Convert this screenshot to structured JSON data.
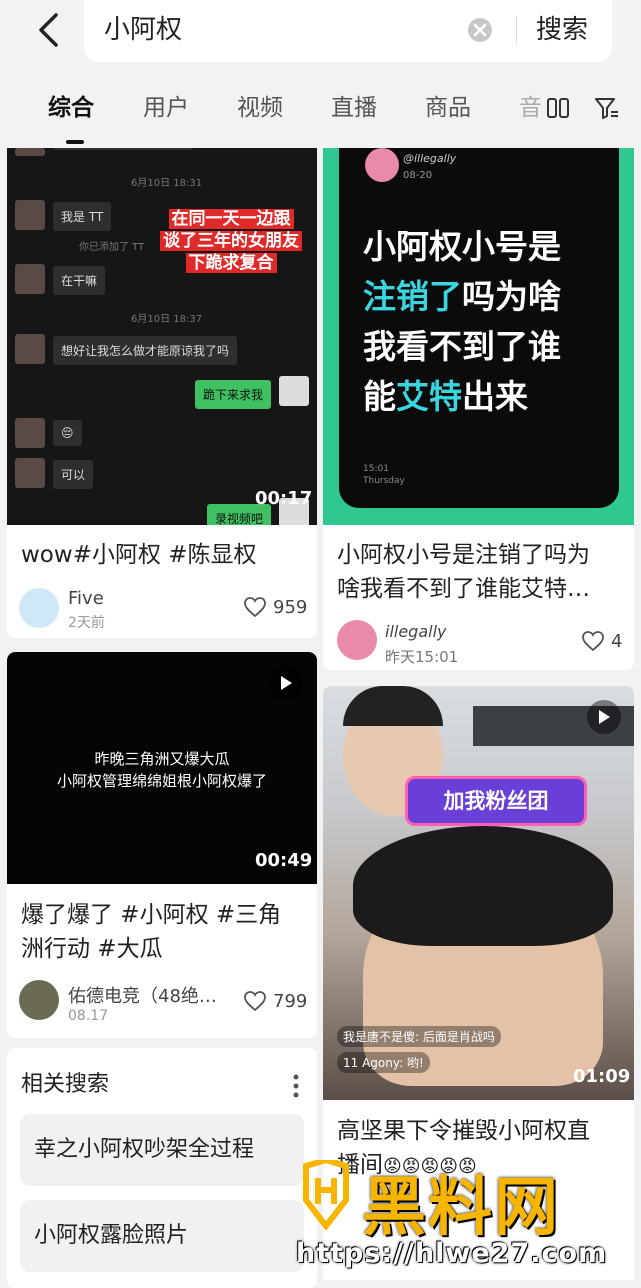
{
  "search": {
    "query": "小阿权",
    "button": "搜索"
  },
  "tabs": [
    "综合",
    "用户",
    "视频",
    "直播",
    "商品",
    "音"
  ],
  "cards": [
    {
      "title": "wow#小阿权 #陈显权",
      "author": "Five",
      "date": "2天前",
      "likes": "959",
      "duration": "00:17",
      "chat": {
        "times": [
          "6月10日 18:31",
          "6月10日 18:37"
        ],
        "added": "你已添加了 TT",
        "messages": [
          "我是 TT",
          "在干嘛",
          "想好让我怎么做才能原谅我了吗",
          "跪下来求我",
          "😔",
          "可以",
          "录视频吧"
        ],
        "overlay": [
          "在同一天一边跟",
          "谈了三年的女朋友",
          "下跪求复合"
        ]
      }
    },
    {
      "title_lines": [
        "小阿权小号是注销了吗为",
        "啥我看不到了谁能艾特…"
      ],
      "author": "illegally",
      "date": "昨天15:01",
      "likes": "4",
      "thumb": {
        "handle": "@illegally",
        "date": "08-20",
        "lines": [
          "小阿权小号是",
          "注销了",
          "吗为啥",
          "我看不到了谁",
          "能",
          "艾特",
          "出来"
        ],
        "time": "15:01",
        "day": "Thursday"
      }
    },
    {
      "title_lines": [
        "爆了爆了 #小阿权 #三角",
        "洲行动 #大瓜"
      ],
      "author": "佑德电竞（48绝…",
      "date": "08.17",
      "likes": "799",
      "duration": "00:49",
      "thumb_lines": [
        "昨晚三角洲又爆大瓜",
        "小阿权管理绵绵姐根小阿权爆了"
      ]
    },
    {
      "title_lines": [
        "高坚果下令摧毁小阿权直",
        "播间"
      ],
      "duration": "01:09",
      "badge": "加我粉丝团",
      "comments": [
        "我是唐不是傻:  后面是肖战吗",
        "11 Agony:  哟!"
      ]
    }
  ],
  "related": {
    "title": "相关搜索",
    "items": [
      "幸之小阿权吵架全过程",
      "小阿权露脸照片"
    ]
  },
  "watermark": {
    "brand": "黑料网",
    "url": "https://hlwe27.com"
  },
  "colors": {
    "accent_green": "#3ad6a4",
    "red": "#e02a2a",
    "watermark": "#f7b500"
  }
}
